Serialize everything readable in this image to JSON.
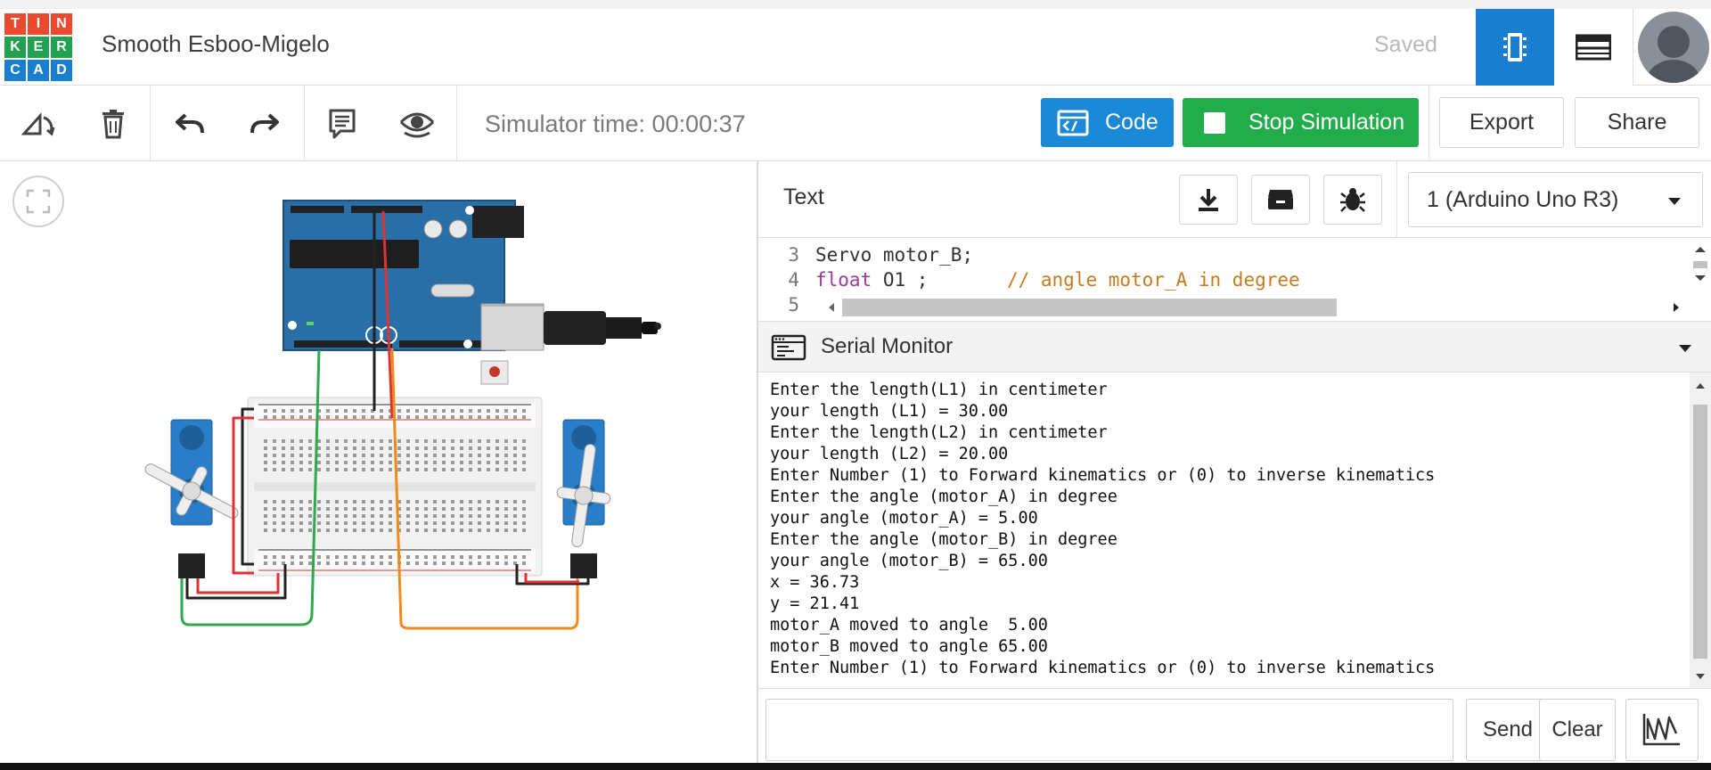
{
  "header": {
    "logo_letters": [
      "T",
      "I",
      "N",
      "K",
      "E",
      "R",
      "C",
      "A",
      "D"
    ],
    "logo_colors": [
      "#e8492f",
      "#e8492f",
      "#e8492f",
      "#22a150",
      "#22a150",
      "#22a150",
      "#1a7fd1",
      "#1a7fd1",
      "#1a7fd1"
    ],
    "project_title": "Smooth Esboo-Migelo",
    "save_status": "Saved",
    "icons": [
      "circuit-view-icon",
      "component-list-icon",
      "user-avatar"
    ]
  },
  "toolbar": {
    "icons": [
      "rotate-icon",
      "delete-icon",
      "undo-icon",
      "redo-icon",
      "notes-icon",
      "visibility-icon"
    ],
    "simulator_time": "Simulator time: 00:00:37",
    "code_label": "Code",
    "stop_label": "Stop Simulation",
    "export_label": "Export",
    "share_label": "Share"
  },
  "code_panel": {
    "editor_mode": "Text",
    "board_selected": "1 (Arduino Uno R3)",
    "actions": [
      "download-icon",
      "library-icon",
      "debug-icon"
    ],
    "code_lines": [
      {
        "num": "3",
        "text": "Servo motor_B;",
        "keyword": "",
        "comment": ""
      },
      {
        "num": "4",
        "text": " O1 ;       ",
        "keyword": "float",
        "comment": "// angle motor_A in degree"
      },
      {
        "num": "5",
        "text": "",
        "keyword": "",
        "comment": ""
      }
    ]
  },
  "serial_monitor": {
    "title": "Serial Monitor",
    "output": [
      "Enter the length(L1) in centimeter",
      "your length (L1) = 30.00",
      "Enter the length(L2) in centimeter",
      "your length (L2) = 20.00",
      "Enter Number (1) to Forward kinematics or (0) to inverse kinematics",
      "Enter the angle (motor_A) in degree",
      "your angle (motor_A) = 5.00",
      "Enter the angle (motor_B) in degree",
      "your angle (motor_B) = 65.00",
      "x = 36.73",
      "y = 21.41",
      "motor_A moved to angle  5.00",
      "motor_B moved to angle 65.00",
      "Enter Number (1) to Forward kinematics or (0) to inverse kinematics"
    ],
    "input_value": "",
    "send_label": "Send",
    "clear_label": "Clear"
  },
  "colors": {
    "accent_blue": "#1a89d6",
    "stop_green": "#22ad4c",
    "arduino_blue": "#2a6ea8",
    "servo_blue": "#2a7dc9"
  }
}
